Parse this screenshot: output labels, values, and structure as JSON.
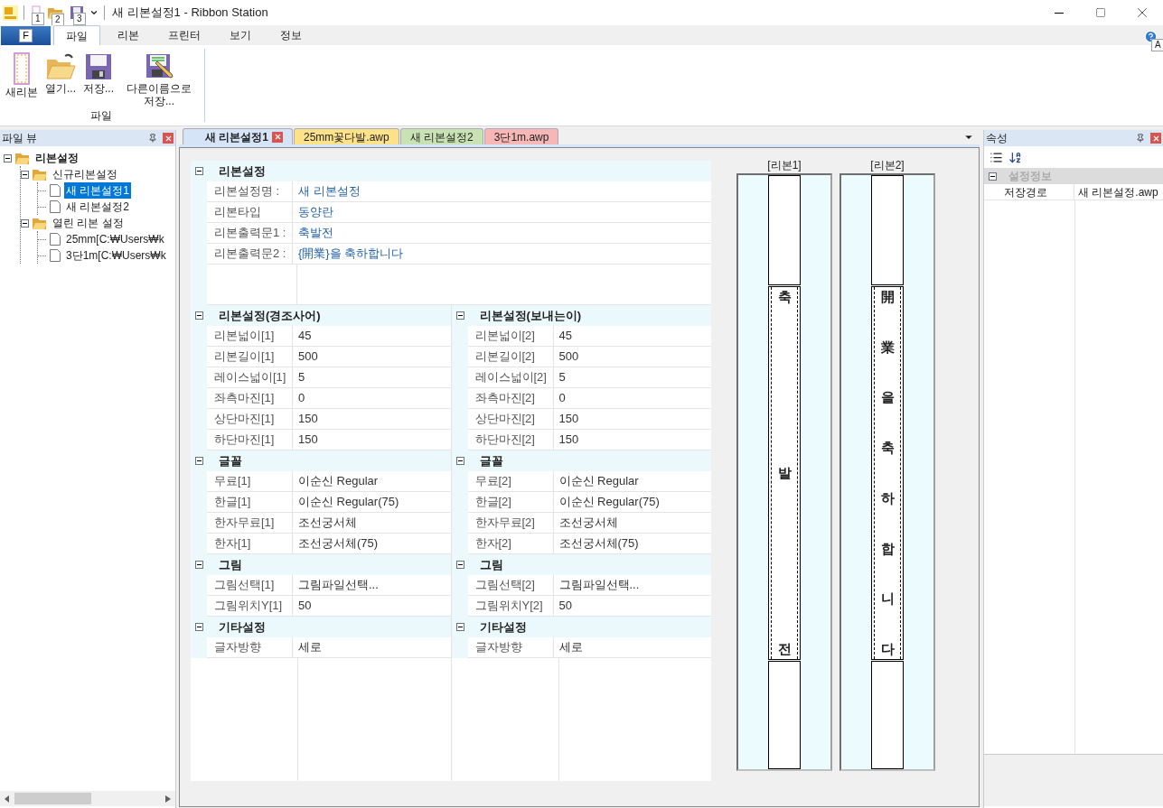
{
  "title_bar": {
    "title": "새 리본설정1 - Ribbon Station",
    "keytips": [
      "1",
      "2",
      "3"
    ]
  },
  "ribbon": {
    "file_button": "F",
    "help_keytip": "A",
    "tabs": [
      {
        "label": "파일",
        "selected": true
      },
      {
        "label": "리본",
        "selected": false
      },
      {
        "label": "프린터",
        "selected": false
      },
      {
        "label": "보기",
        "selected": false
      },
      {
        "label": "정보",
        "selected": false
      }
    ],
    "groups": [
      {
        "label": "파일",
        "buttons": [
          {
            "label": "새리본",
            "kind": "new"
          },
          {
            "label": "열기...",
            "kind": "open"
          },
          {
            "label": "저장...",
            "kind": "save"
          },
          {
            "label": "다른이름으로 저장...",
            "kind": "saveas"
          }
        ]
      }
    ]
  },
  "file_view": {
    "title": "파일 뷰",
    "tree": [
      {
        "label": "리본설정",
        "kind": "folder",
        "bold": true,
        "selected": false,
        "children": [
          {
            "label": "신규리본설정",
            "kind": "folder",
            "bold": false,
            "selected": false,
            "children": [
              {
                "label": "새 리본설정1",
                "kind": "file",
                "bold": false,
                "selected": true
              },
              {
                "label": "새 리본설정2",
                "kind": "file",
                "bold": false,
                "selected": false
              }
            ]
          },
          {
            "label": "열린 리본 설정",
            "kind": "folder",
            "bold": false,
            "selected": false,
            "children": [
              {
                "label": "25mm[C:₩Users₩k",
                "kind": "file",
                "bold": false,
                "selected": false
              },
              {
                "label": "3단1m[C:₩Users₩k",
                "kind": "file",
                "bold": false,
                "selected": false
              }
            ]
          }
        ]
      }
    ]
  },
  "document_tabs": [
    {
      "label": "새 리본설정1",
      "selected": true,
      "color": "#d6e4f7",
      "closable": true
    },
    {
      "label": "25mm꽃다발.awp",
      "selected": false,
      "color": "#fde28a",
      "closable": false
    },
    {
      "label": "새 리본설정2",
      "selected": false,
      "color": "#c9e2b3",
      "closable": false
    },
    {
      "label": "3단1m.awp",
      "selected": false,
      "color": "#f7b7b7",
      "closable": false
    }
  ],
  "main_settings": {
    "title": "리본설정",
    "rows": [
      {
        "label": "리본설정명 :",
        "value": "새 리본설정"
      },
      {
        "label": "리본타입",
        "value": "동양란"
      },
      {
        "label": "리본출력문1 :",
        "value": "축발전"
      },
      {
        "label": "리본출력문2 :",
        "value": "{開業}을 축하합니다"
      }
    ]
  },
  "columns": [
    {
      "sections": [
        {
          "title": "리본설정(경조사어)",
          "rows": [
            {
              "label": "리본넓이[1]",
              "value": "45"
            },
            {
              "label": "리본길이[1]",
              "value": "500"
            },
            {
              "label": "레이스넓이[1]",
              "value": "5"
            },
            {
              "label": "좌측마진[1]",
              "value": "0"
            },
            {
              "label": "상단마진[1]",
              "value": "150"
            },
            {
              "label": "하단마진[1]",
              "value": "150"
            }
          ]
        },
        {
          "title": "글꼴",
          "rows": [
            {
              "label": "무료[1]",
              "value": "이순신 Regular"
            },
            {
              "label": "한글[1]",
              "value": "이순신 Regular(75)"
            },
            {
              "label": "한자무료[1]",
              "value": "조선궁서체"
            },
            {
              "label": "한자[1]",
              "value": "조선궁서체(75)"
            }
          ]
        },
        {
          "title": "그림",
          "rows": [
            {
              "label": "그림선택[1]",
              "value": "그림파일선택..."
            },
            {
              "label": "그림위치Y[1]",
              "value": "50"
            }
          ]
        },
        {
          "title": "기타설정",
          "rows": [
            {
              "label": "글자방향",
              "value": "세로"
            }
          ]
        }
      ]
    },
    {
      "sections": [
        {
          "title": "리본설정(보내는이)",
          "rows": [
            {
              "label": "리본넓이[2]",
              "value": "45"
            },
            {
              "label": "리본길이[2]",
              "value": "500"
            },
            {
              "label": "레이스넓이[2]",
              "value": "5"
            },
            {
              "label": "좌측마진[2]",
              "value": "0"
            },
            {
              "label": "상단마진[2]",
              "value": "150"
            },
            {
              "label": "하단마진[2]",
              "value": "150"
            }
          ]
        },
        {
          "title": "글꼴",
          "rows": [
            {
              "label": "무료[2]",
              "value": "이순신 Regular"
            },
            {
              "label": "한글[2]",
              "value": "이순신 Regular(75)"
            },
            {
              "label": "한자무료[2]",
              "value": "조선궁서체"
            },
            {
              "label": "한자[2]",
              "value": "조선궁서체(75)"
            }
          ]
        },
        {
          "title": "그림",
          "rows": [
            {
              "label": "그림선택[2]",
              "value": "그림파일선택..."
            },
            {
              "label": "그림위치Y[2]",
              "value": "50"
            }
          ]
        },
        {
          "title": "기타설정",
          "rows": [
            {
              "label": "글자방향",
              "value": "세로"
            }
          ]
        }
      ]
    }
  ],
  "previews": [
    {
      "label": "[리본1]",
      "chars": [
        "축",
        "발",
        "전"
      ]
    },
    {
      "label": "[리본2]",
      "chars": [
        "開",
        "業",
        "을",
        "축",
        "하",
        "합",
        "니",
        "다"
      ]
    }
  ],
  "properties": {
    "title": "속성",
    "category": "설정정보",
    "rows": [
      {
        "label": "저장경로",
        "value": "새 리본설정.awp"
      }
    ]
  }
}
